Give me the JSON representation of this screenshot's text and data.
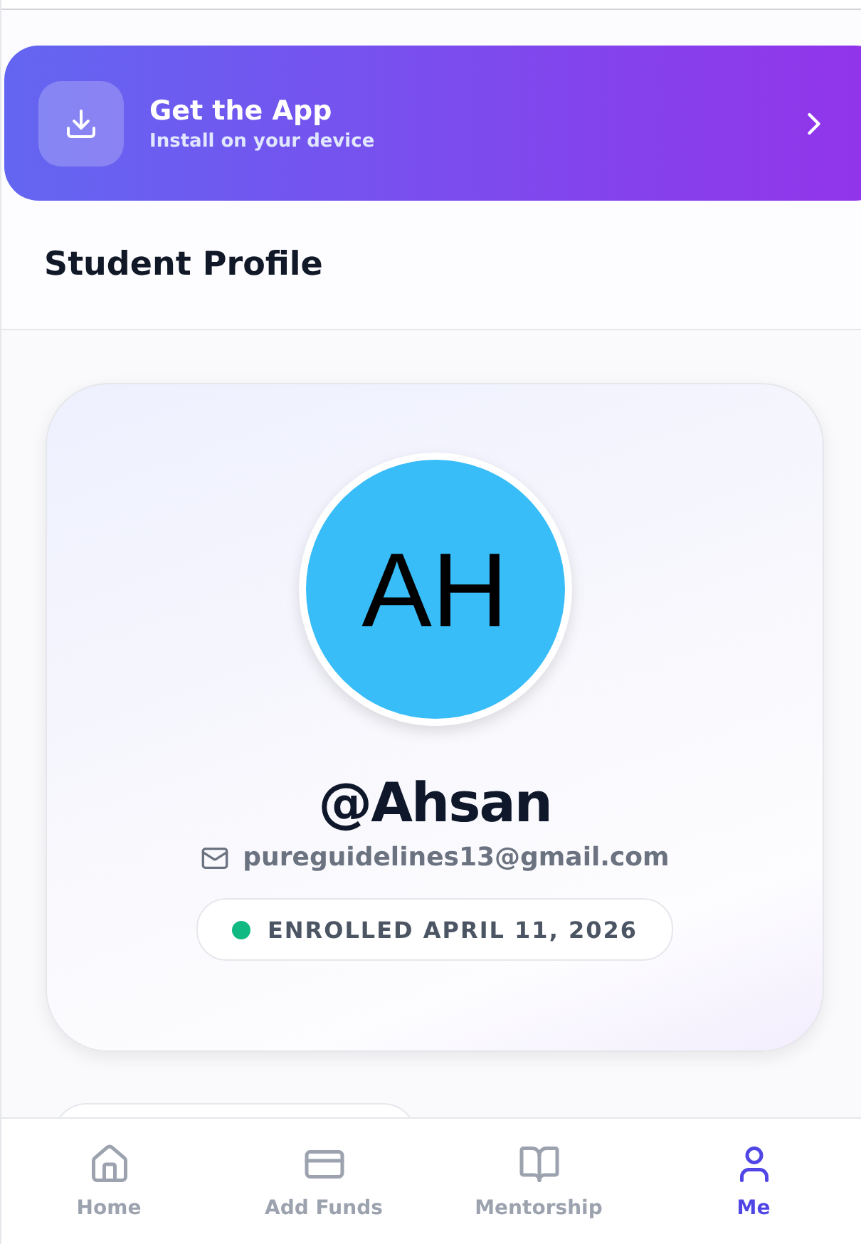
{
  "banner": {
    "title": "Get the App",
    "subtitle": "Install on your device"
  },
  "header": {
    "title": "Student Profile"
  },
  "profile": {
    "initials": "AH",
    "username": "@Ahsan",
    "email": "pureguidelines13@gmail.com",
    "enrolled": {
      "label": "ENROLLED APRIL 11, 2026",
      "color": "#10b981"
    }
  },
  "nav": [
    {
      "label": "Home",
      "selected": false
    },
    {
      "label": "Add Funds",
      "selected": false
    },
    {
      "label": "Mentorship",
      "selected": false
    },
    {
      "label": "Me",
      "selected": true
    }
  ]
}
